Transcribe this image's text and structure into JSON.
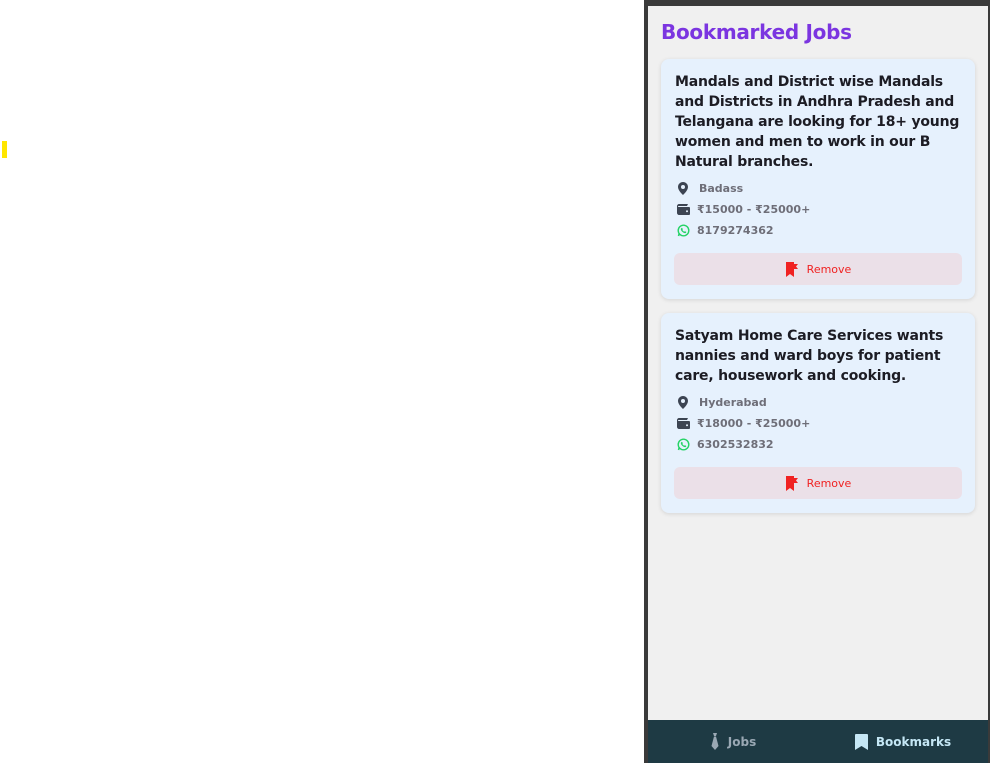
{
  "page": {
    "title": "Bookmarked Jobs"
  },
  "jobs": [
    {
      "title": "Mandals and District wise Mandals and Districts in Andhra Pradesh and Telangana are looking for 18+ young women and men to work in our B Natural branches.",
      "location": "Badass",
      "salary": "₹15000 - ₹25000+",
      "phone": "8179274362",
      "remove_label": "Remove"
    },
    {
      "title": "Satyam Home Care Services wants nannies and ward boys for patient care, housework and cooking.",
      "location": "Hyderabad",
      "salary": "₹18000 - ₹25000+",
      "phone": "6302532832",
      "remove_label": "Remove"
    }
  ],
  "nav": {
    "jobs_label": "Jobs",
    "bookmarks_label": "Bookmarks",
    "active": "Bookmarks"
  },
  "icons": {
    "location": "map-pin-icon",
    "salary": "wallet-icon",
    "phone": "whatsapp-icon",
    "remove": "bookmark-remove-icon",
    "nav_jobs": "tie-icon",
    "nav_bookmarks": "bookmark-icon"
  },
  "colors": {
    "accent": "#7b35e0",
    "remove_text": "#f02222",
    "whatsapp": "#25d366",
    "nav_background": "#1e3a44",
    "card_background": "#e6f1fd"
  }
}
